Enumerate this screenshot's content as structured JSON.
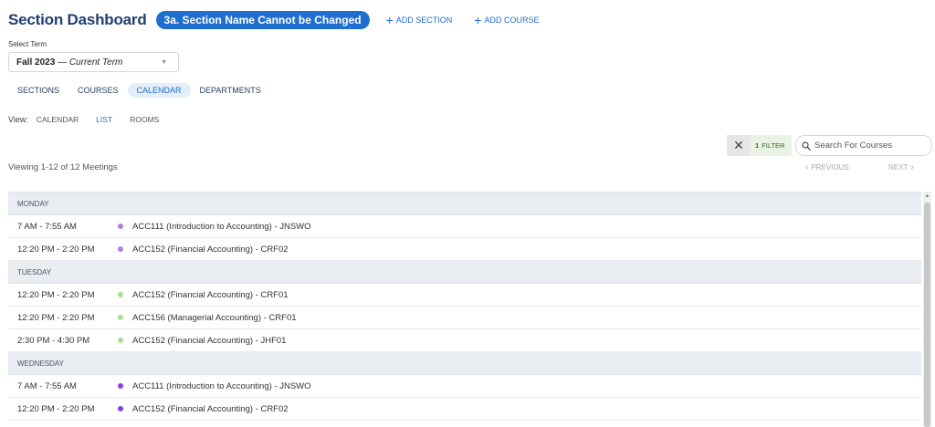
{
  "header": {
    "title": "Section Dashboard",
    "section_pill": "3a. Section Name Cannot be Changed",
    "add_section": "ADD SECTION",
    "add_course": "ADD COURSE",
    "plus_glyph": "+"
  },
  "term": {
    "label": "Select Term",
    "selected_name": "Fall 2023",
    "selected_suffix": "— Current Term"
  },
  "main_tabs": [
    {
      "label": "SECTIONS",
      "active": false
    },
    {
      "label": "COURSES",
      "active": false
    },
    {
      "label": "CALENDAR",
      "active": true
    },
    {
      "label": "DEPARTMENTS",
      "active": false
    }
  ],
  "view": {
    "label": "View:",
    "options": [
      {
        "label": "CALENDAR",
        "active": false
      },
      {
        "label": "LIST",
        "active": true
      },
      {
        "label": "ROOMS",
        "active": false
      }
    ]
  },
  "filter": {
    "count": "1",
    "label": "FILTER",
    "clear_glyph": "✕"
  },
  "search": {
    "placeholder": "Search For Courses"
  },
  "viewing_text": "Viewing 1-12 of 12 Meetings",
  "pager": {
    "previous": "PREVIOUS",
    "next": "NEXT"
  },
  "colors": {
    "accent": "#1f6fd1",
    "title": "#1f3f73",
    "dot_monday": "#b57be0",
    "dot_tuesday": "#a6e08a",
    "dot_wednesday": "#8a3ee0"
  },
  "schedule": [
    {
      "day": "MONDAY",
      "meetings": [
        {
          "time": "7 AM - 7:55 AM",
          "course": "ACC111 (Introduction to Accounting) - JNSWO",
          "dot": "#b57be0"
        },
        {
          "time": "12:20 PM - 2:20 PM",
          "course": "ACC152 (Financial Accounting) - CRF02",
          "dot": "#b57be0"
        }
      ]
    },
    {
      "day": "TUESDAY",
      "meetings": [
        {
          "time": "12:20 PM - 2:20 PM",
          "course": "ACC152 (Financial Accounting) - CRF01",
          "dot": "#a6e08a"
        },
        {
          "time": "12:20 PM - 2:20 PM",
          "course": "ACC156 (Managerial Accounting) - CRF01",
          "dot": "#a6e08a"
        },
        {
          "time": "2:30 PM - 4:30 PM",
          "course": "ACC152 (Financial Accounting) - JHF01",
          "dot": "#a6e08a"
        }
      ]
    },
    {
      "day": "WEDNESDAY",
      "meetings": [
        {
          "time": "7 AM - 7:55 AM",
          "course": "ACC111 (Introduction to Accounting) - JNSWO",
          "dot": "#8a3ee0"
        },
        {
          "time": "12:20 PM - 2:20 PM",
          "course": "ACC152 (Financial Accounting) - CRF02",
          "dot": "#8a3ee0"
        }
      ]
    }
  ]
}
